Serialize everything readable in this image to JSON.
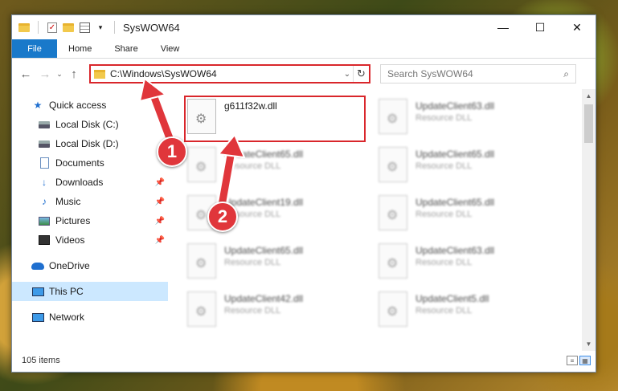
{
  "window": {
    "title": "SysWOW64",
    "controls": {
      "minimize": "—",
      "maximize": "☐",
      "close": "✕"
    }
  },
  "ribbon": {
    "tabs": [
      {
        "label": "File"
      },
      {
        "label": "Home"
      },
      {
        "label": "Share"
      },
      {
        "label": "View"
      }
    ]
  },
  "address": {
    "path": "C:\\Windows\\SysWOW64",
    "search_placeholder": "Search SysWOW64"
  },
  "nav": {
    "quick_access": "Quick access",
    "items": [
      {
        "label": "Local Disk (C:)",
        "icon": "disk-icon"
      },
      {
        "label": "Local Disk (D:)",
        "icon": "disk-icon"
      },
      {
        "label": "Documents",
        "icon": "documents-icon"
      },
      {
        "label": "Downloads",
        "icon": "downloads-icon",
        "pinned": true
      },
      {
        "label": "Music",
        "icon": "music-icon",
        "pinned": true
      },
      {
        "label": "Pictures",
        "icon": "pictures-icon",
        "pinned": true
      },
      {
        "label": "Videos",
        "icon": "videos-icon",
        "pinned": true
      }
    ],
    "onedrive": "OneDrive",
    "this_pc": "This PC",
    "network": "Network"
  },
  "files": [
    {
      "name": "g611f32w.dll",
      "type": "",
      "highlight": true
    },
    {
      "name": "UpdateClient63.dll",
      "type": "Resource DLL"
    },
    {
      "name": "UpdateClient65.dll",
      "type": "Resource DLL"
    },
    {
      "name": "UpdateClient65.dll",
      "type": "Resource DLL"
    },
    {
      "name": "UpdateClient19.dll",
      "type": "Resource DLL"
    },
    {
      "name": "UpdateClient65.dll",
      "type": "Resource DLL"
    },
    {
      "name": "UpdateClient65.dll",
      "type": "Resource DLL"
    },
    {
      "name": "UpdateClient63.dll",
      "type": "Resource DLL"
    },
    {
      "name": "UpdateClient42.dll",
      "type": "Resource DLL"
    },
    {
      "name": "UpdateClient5.dll",
      "type": "Resource DLL"
    }
  ],
  "status": {
    "item_count": "105 items"
  },
  "annotations": {
    "marker1": "1",
    "marker2": "2",
    "color": "#e0363b"
  }
}
